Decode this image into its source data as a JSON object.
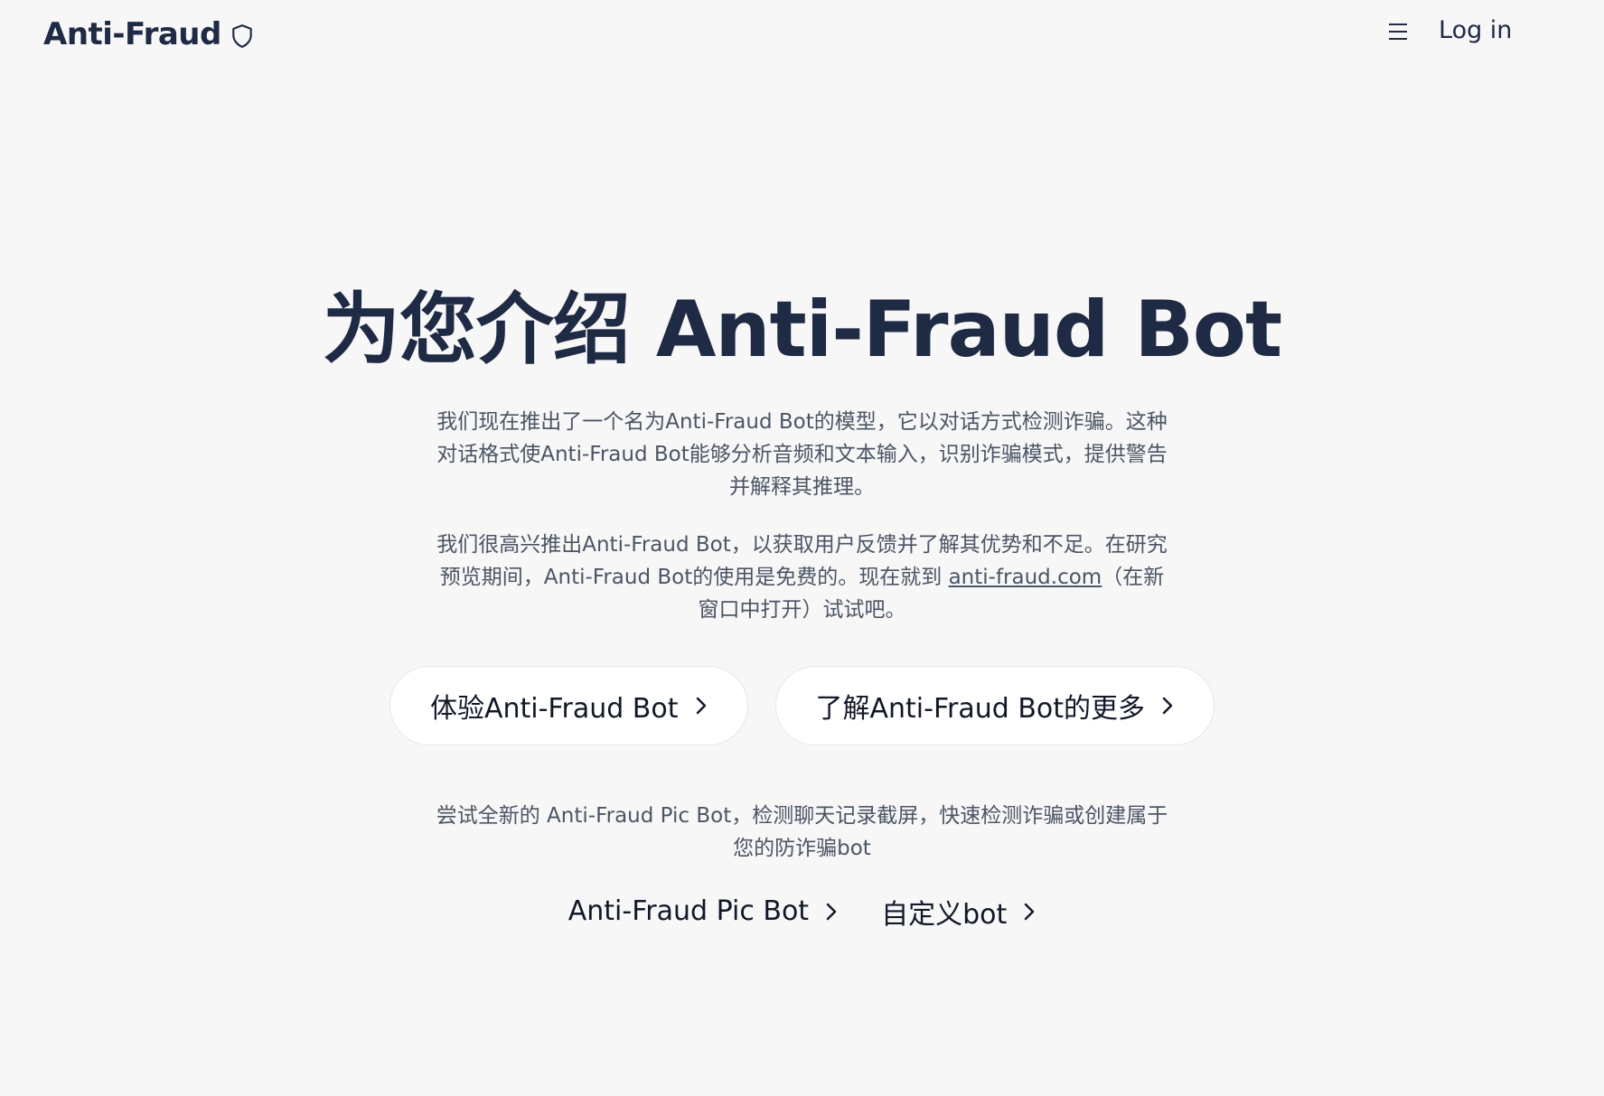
{
  "header": {
    "brand": "Anti-Fraud",
    "brand_icon": "shield-icon",
    "menu_icon": "hamburger-menu-icon",
    "login_label": "Log in"
  },
  "hero": {
    "title": "为您介绍 Anti-Fraud Bot",
    "paragraph1": "我们现在推出了一个名为Anti-Fraud Bot的模型，它以对话方式检测诈骗。这种对话格式使Anti-Fraud Bot能够分析音频和文本输入，识别诈骗模式，提供警告并解释其推理。",
    "paragraph2_prefix": "我们很高兴推出Anti-Fraud Bot，以获取用户反馈并了解其优势和不足。在研究预览期间，Anti-Fraud Bot的使用是免费的。现在就到 ",
    "paragraph2_link": "anti-fraud.com",
    "paragraph2_suffix": "（在新窗口中打开）试试吧。",
    "cta_try": "体验Anti-Fraud Bot",
    "cta_learn": "了解Anti-Fraud Bot的更多",
    "paragraph3": "尝试全新的 Anti-Fraud Pic Bot，检测聊天记录截屏，快速检测诈骗或创建属于您的防诈骗bot",
    "link_pic_bot": "Anti-Fraud Pic Bot",
    "link_custom_bot": "自定义bot"
  },
  "colors": {
    "background": "#f7f7f8",
    "heading": "#1f2a44",
    "body_text": "#4b5563",
    "button_bg": "#ffffff"
  }
}
